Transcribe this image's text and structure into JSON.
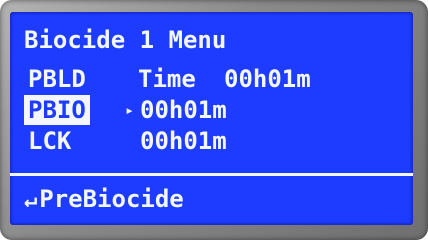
{
  "screen": {
    "title": "Biocide 1 Menu",
    "rows": [
      {
        "label": "PBLD",
        "prefix": "Time",
        "value": "00h01m",
        "selected": false
      },
      {
        "label": "PBIO",
        "cursor": "▸",
        "value": "00h01m",
        "selected": true
      },
      {
        "label": "LCK",
        "value": "00h01m",
        "selected": false
      }
    ],
    "footer": {
      "back_icon": "↵",
      "label": "PreBiocide"
    }
  },
  "colors": {
    "screen_bg": "#1d3cff",
    "text": "#f2f6ff",
    "bezel": "#8a8a8a"
  },
  "icons": {
    "cursor": "triangle-right-icon",
    "back": "return-arrow-icon"
  }
}
